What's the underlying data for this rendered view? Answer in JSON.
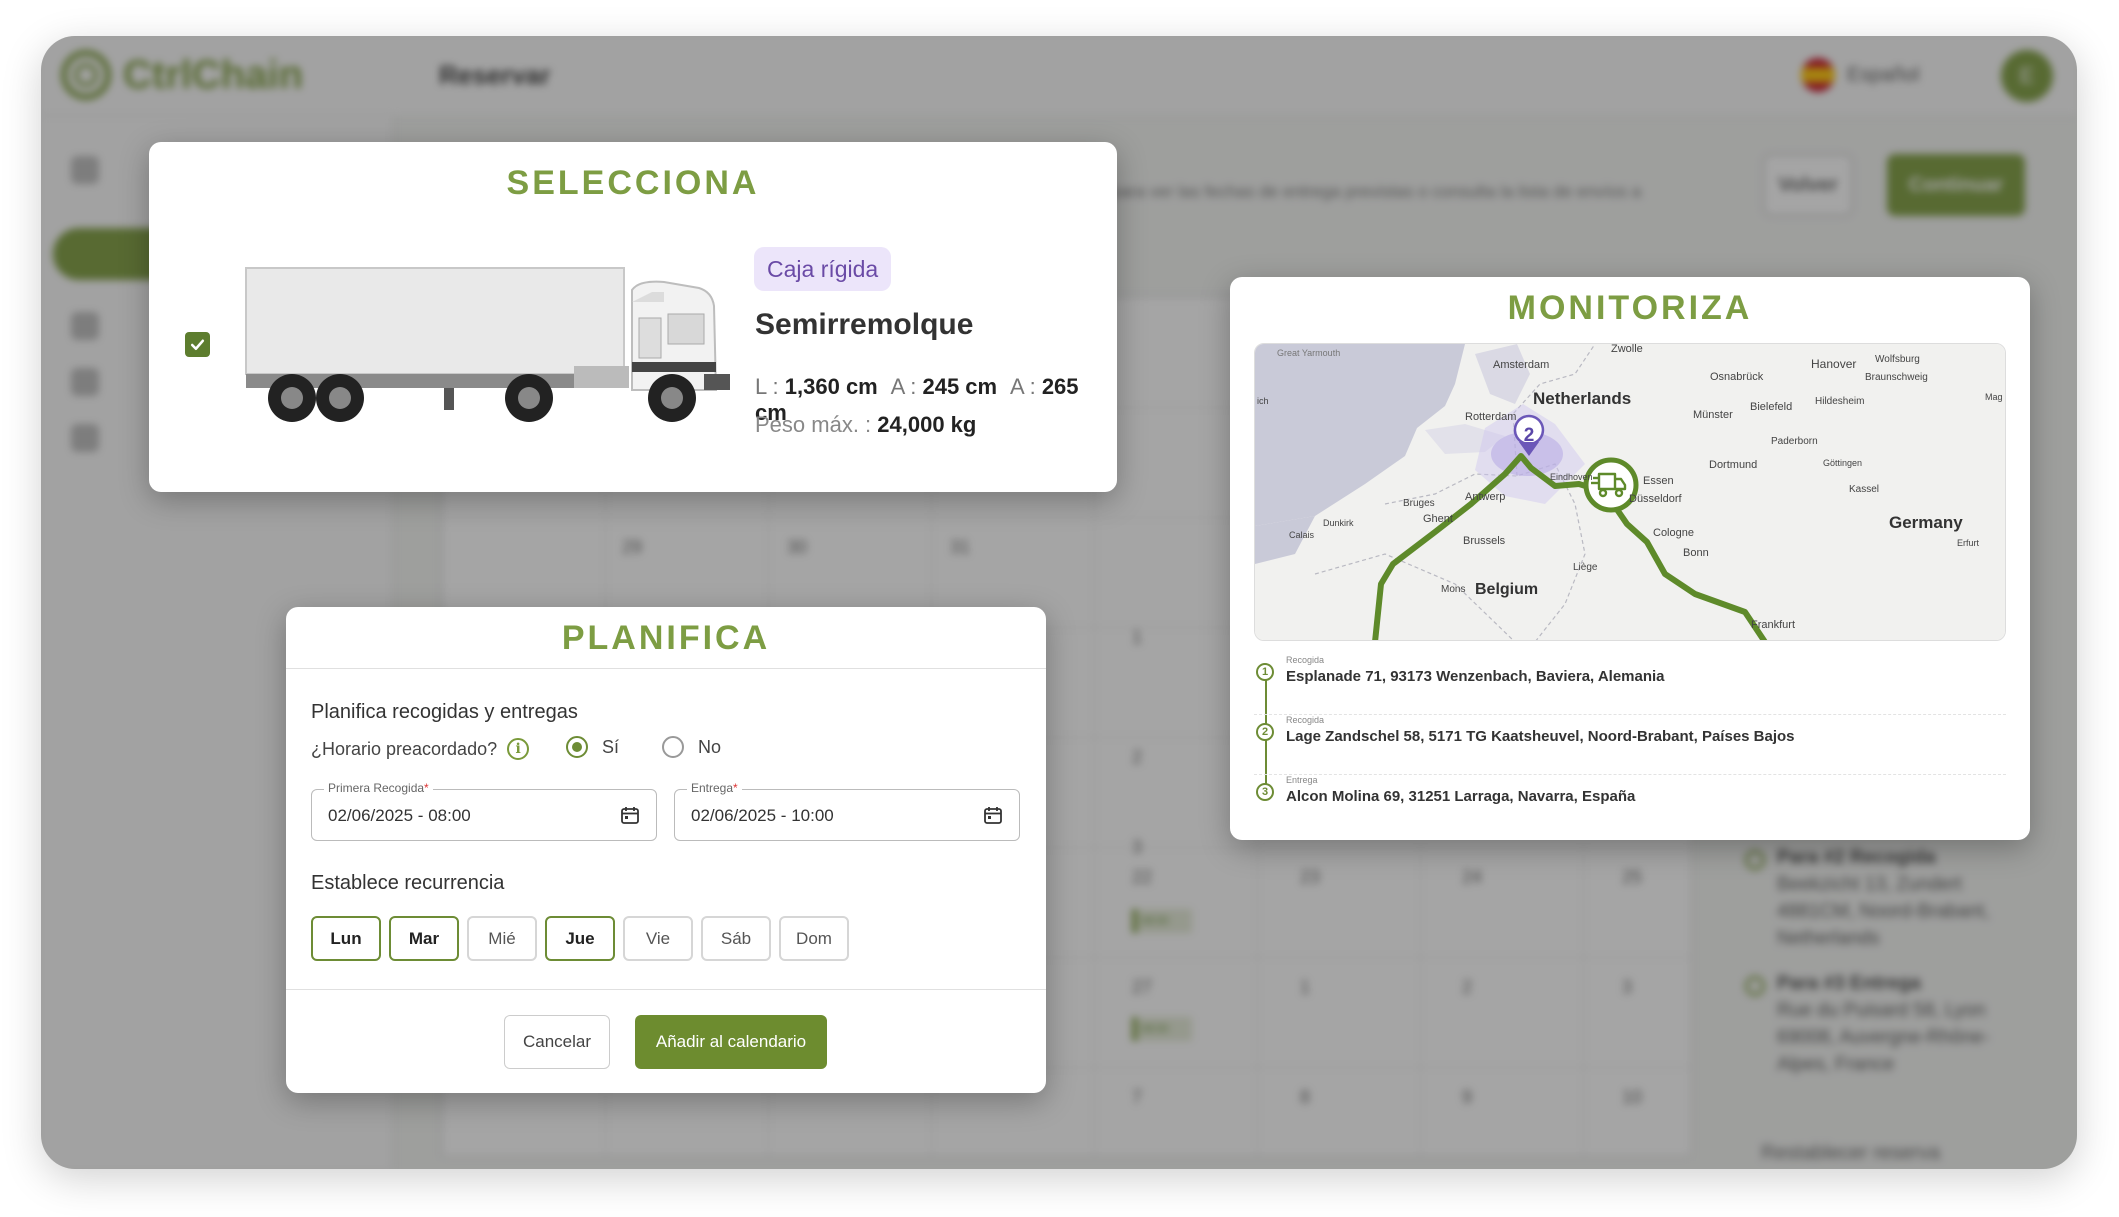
{
  "background": {
    "logo_text": "CtrlChain",
    "page_title": "Reservar",
    "language": "Español",
    "avatar_initial": "E",
    "back_button": "Volver",
    "continue_button": "Continuar",
    "description": "para ver las fechas de entrega previstas o consulta la lista de envíos a",
    "calendar_numbers": [
      "29",
      "30",
      "31",
      "1",
      "2",
      "3",
      "22",
      "23",
      "24",
      "25",
      "26",
      "27",
      "1",
      "2",
      "3",
      "7",
      "8",
      "9",
      "10"
    ],
    "event_label": "08:00",
    "stops": [
      {
        "title": "Para #2 Recogida",
        "address": "Beekzicht 13, Zundert 4881CM, Noord-Brabant, Netherlands"
      },
      {
        "title": "Para #3 Entrega",
        "address": "Rue du Puisard 58, Lyon 69008, Auvergne-Rhône-Alpes, France"
      }
    ],
    "footer_link": "Restablecer reserva"
  },
  "select": {
    "title": "SELECCIONA",
    "badge": "Caja rígida",
    "vehicle_name": "Semirremolque",
    "dims": {
      "l_label": "L :",
      "l_value": "1,360 cm",
      "a1_label": "A :",
      "a1_value": "245 cm",
      "a2_label": "A :",
      "a2_value": "265 cm"
    },
    "weight_label": "Peso máx. :",
    "weight_value": "24,000 kg",
    "checked": true
  },
  "plan": {
    "title": "PLANIFICA",
    "section1": "Planifica recogidas y entregas",
    "question": "¿Horario preacordado?",
    "yes": "Sí",
    "no": "No",
    "first_pickup_label": "Primera Recogida",
    "first_pickup_value": "02/06/2025 - 08:00",
    "delivery_label": "Entrega",
    "delivery_value": "02/06/2025 - 10:00",
    "required_mark": "*",
    "section2": "Establece recurrencia",
    "days": [
      {
        "label": "Lun",
        "selected": true
      },
      {
        "label": "Mar",
        "selected": true
      },
      {
        "label": "Mié",
        "selected": false
      },
      {
        "label": "Jue",
        "selected": true
      },
      {
        "label": "Vie",
        "selected": false
      },
      {
        "label": "Sáb",
        "selected": false
      },
      {
        "label": "Dom",
        "selected": false
      }
    ],
    "cancel": "Cancelar",
    "add": "Añadir al calendario"
  },
  "monitor": {
    "title": "MONITORIZA",
    "map_labels": {
      "great_yarmouth": "Great Yarmouth",
      "amsterdam": "Amsterdam",
      "zwolle": "Zwolle",
      "netherlands": "Netherlands",
      "osnabruck": "Osnabrück",
      "hanover": "Hanover",
      "wolfsburg": "Wolfsburg",
      "braunschweig": "Braunschweig",
      "hildesheim": "Hildesheim",
      "bielefeld": "Bielefeld",
      "munster": "Münster",
      "rotterdam": "Rotterdam",
      "paderborn": "Paderborn",
      "dortmund": "Dortmund",
      "gottingen": "Göttingen",
      "essen": "Essen",
      "eindhoven": "Eindhoven",
      "dusseldorf": "Düsseldorf",
      "kassel": "Kassel",
      "bruges": "Bruges",
      "ghent": "Ghent",
      "antwerp": "Antwerp",
      "germany": "Germany",
      "dunkirk": "Dunkirk",
      "calais": "Calais",
      "cologne": "Cologne",
      "erfurt": "Erfurt",
      "brussels": "Brussels",
      "bonn": "Bonn",
      "liege": "Liège",
      "mons": "Mons",
      "belgium": "Belgium",
      "frankfurt": "Frankfurt",
      "ich": "ich",
      "mag": "Mag",
      "marker_number": "2"
    },
    "stops": [
      {
        "num": "1",
        "kind": "Recogida",
        "address": "Esplanade 71, 93173 Wenzenbach, Baviera, Alemania"
      },
      {
        "num": "2",
        "kind": "Recogida",
        "address": "Lage Zandschel 58, 5171 TG Kaatsheuvel, Noord-Brabant, Países Bajos"
      },
      {
        "num": "3",
        "kind": "Entrega",
        "address": "Alcon Molina 69, 31251 Larraga, Navarra, España"
      }
    ]
  },
  "colors": {
    "brand_green": "#7d9d43",
    "button_green": "#6d8c2f",
    "badge_bg": "#ece5fa",
    "badge_text": "#6a4aa6",
    "route": "#5e8a2a"
  }
}
